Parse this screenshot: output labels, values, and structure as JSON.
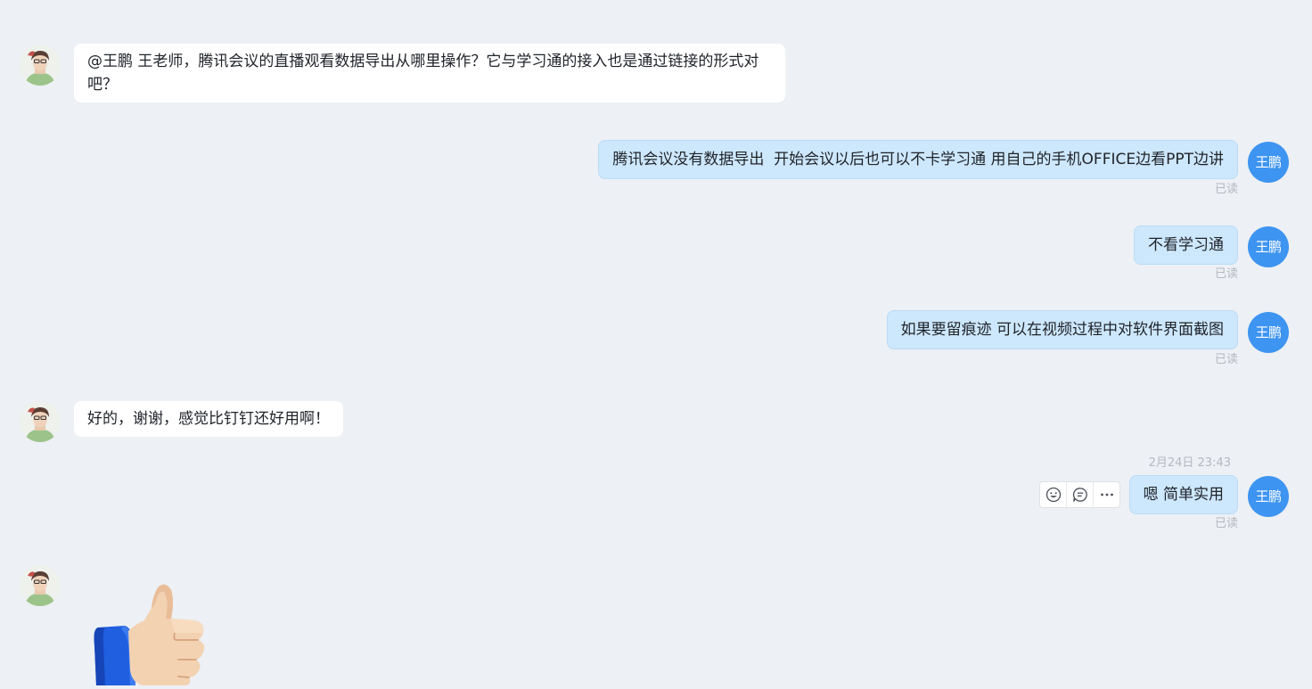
{
  "messages": [
    {
      "id": "m1",
      "direction": "incoming",
      "text": "@王鹏 王老师，腾讯会议的直播观看数据导出从哪里操作？它与学习通的接入也是通过链接的形式对吧？"
    },
    {
      "id": "m2",
      "direction": "outgoing",
      "avatar_text": "王鹏",
      "text": "腾讯会议没有数据导出  开始会议以后也可以不卡学习通 用自己的手机OFFICE边看PPT边讲",
      "status": "已读"
    },
    {
      "id": "m3",
      "direction": "outgoing",
      "avatar_text": "王鹏",
      "text": "不看学习通",
      "status": "已读"
    },
    {
      "id": "m4",
      "direction": "outgoing",
      "avatar_text": "王鹏",
      "text": "如果要留痕迹 可以在视频过程中对软件界面截图",
      "status": "已读"
    },
    {
      "id": "m5",
      "direction": "incoming",
      "text": "好的，谢谢，感觉比钉钉还好用啊！"
    },
    {
      "id": "m6",
      "direction": "outgoing",
      "avatar_text": "王鹏",
      "timestamp": "2月24日 23:43",
      "text": "嗯 简单实用",
      "status": "已读",
      "actions": [
        "emoji-reaction-icon",
        "reply-icon",
        "more-icon"
      ]
    },
    {
      "id": "m7",
      "direction": "incoming",
      "sticker": "thumbs-up-sticker"
    }
  ],
  "colors": {
    "background": "#edf0f4",
    "incoming_bubble": "#ffffff",
    "outgoing_bubble": "#cde7fc",
    "my_avatar": "#3d94f1",
    "muted_text": "#b4b8bf"
  }
}
